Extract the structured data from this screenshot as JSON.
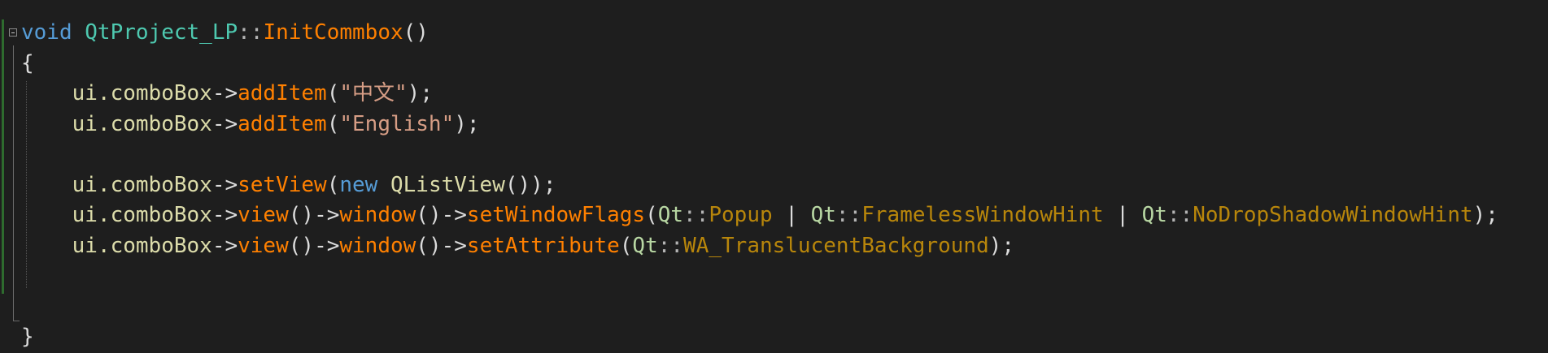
{
  "editor": {
    "lines": [
      {
        "tokens": [
          "void",
          " ",
          "QtProject_LP",
          "::",
          "InitCommbox",
          "()"
        ]
      },
      {
        "tokens": [
          "{"
        ]
      },
      {
        "tokens": [
          "    ",
          "ui.comboBox",
          "->",
          "addItem",
          "(",
          "\"中文\"",
          ");"
        ]
      },
      {
        "tokens": [
          "    ",
          "ui.comboBox",
          "->",
          "addItem",
          "(",
          "\"English\"",
          ");"
        ]
      },
      {
        "tokens": [
          ""
        ]
      },
      {
        "tokens": [
          "    ",
          "ui.comboBox",
          "->",
          "setView",
          "(",
          "new",
          " ",
          "QListView",
          "());"
        ]
      },
      {
        "tokens": [
          "    ",
          "ui.comboBox",
          "->",
          "view",
          "()",
          "->",
          "window",
          "()",
          "->",
          "setWindowFlags",
          "(",
          "Qt",
          "::",
          "Popup",
          " | ",
          "Qt",
          "::",
          "FramelessWindowHint",
          " | ",
          "Qt",
          "::",
          "NoDropShadowWindowHint",
          ");"
        ]
      },
      {
        "tokens": [
          "    ",
          "ui.comboBox",
          "->",
          "view",
          "()",
          "->",
          "window",
          "()",
          "->",
          "setAttribute",
          "(",
          "Qt",
          "::",
          "WA_TranslucentBackground",
          ");"
        ]
      },
      {
        "tokens": [
          ""
        ]
      },
      {
        "tokens": [
          ""
        ]
      },
      {
        "tokens": [
          "}"
        ]
      }
    ]
  },
  "colors": {
    "background": "#1e1e1e",
    "keyword": "#569cd6",
    "class": "#4ec9b0",
    "function": "#ff8000",
    "string": "#d69d85",
    "enum_namespace": "#b8d7a3",
    "enum_value": "#b8860b",
    "plain": "#dcdcdc",
    "change_bar": "#2e6b2e"
  },
  "icons": {
    "fold": "collapse-minus-icon"
  }
}
